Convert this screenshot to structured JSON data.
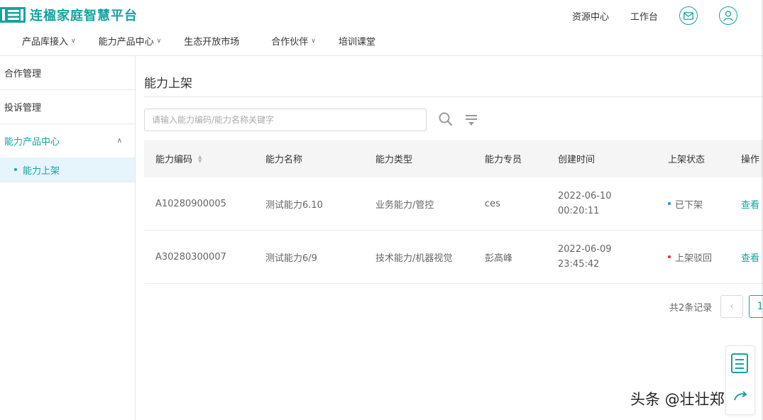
{
  "header": {
    "logo_text": "连楹家庭智慧平台",
    "top_links": [
      "资源中心",
      "工作台"
    ],
    "icons": [
      "mail-icon",
      "user-icon"
    ],
    "nav": [
      {
        "label": "产品库接入",
        "dropdown": true
      },
      {
        "label": "能力产品中心",
        "dropdown": true
      },
      {
        "label": "生态开放市场",
        "dropdown": false
      },
      {
        "label": "合作伙伴",
        "dropdown": true
      },
      {
        "label": "培训课堂",
        "dropdown": false
      }
    ]
  },
  "sidebar": {
    "items": [
      "合作管理",
      "投诉管理"
    ],
    "group": {
      "label": "能力产品中心",
      "expanded": true,
      "sub_items": [
        "能力上架"
      ]
    }
  },
  "main": {
    "title": "能力上架",
    "search_placeholder": "请输入能力编码/能力名称关键字",
    "columns": [
      "能力编码",
      "能力名称",
      "能力类型",
      "能力专员",
      "创建时间",
      "上架状态",
      "操作"
    ],
    "rows": [
      {
        "code": "A10280900005",
        "name": "测试能力6.10",
        "type": "业务能力/管控",
        "staff": "ces",
        "date": "2022-06-10",
        "time": "00:20:11",
        "status": "已下架",
        "status_color": "#1890ff",
        "action": "查看"
      },
      {
        "code": "A30280300007",
        "name": "测试能力6/9",
        "type": "技术能力/机器视觉",
        "staff": "彭高峰",
        "date": "2022-06-09",
        "time": "23:45:42",
        "status": "上架驳回",
        "status_color": "#f5222d",
        "action": "查看"
      }
    ],
    "pagination": {
      "total_text": "共2条记录",
      "current_page": "1"
    }
  },
  "accent_color": "#14a3a1",
  "watermark": "头条 @壮壮郑"
}
